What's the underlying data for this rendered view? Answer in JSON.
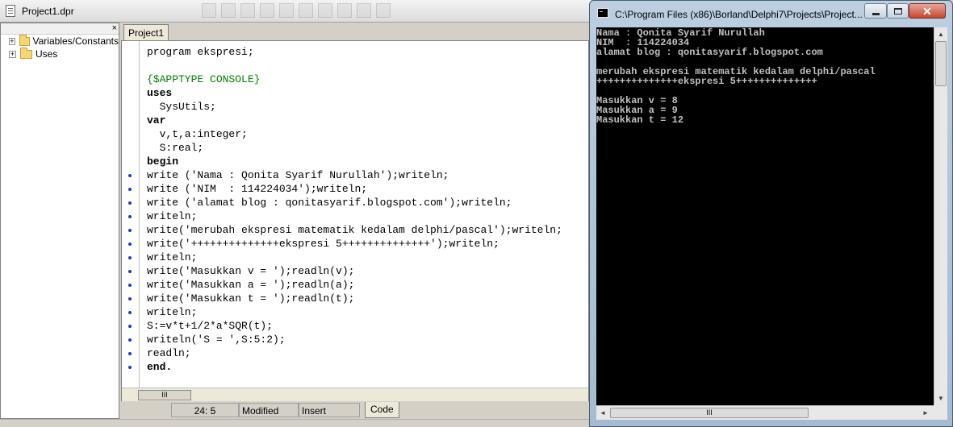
{
  "ide": {
    "title": "Project1.dpr",
    "explorer": {
      "close_glyph": "×",
      "items": [
        {
          "expander": "+",
          "label": "Variables/Constants"
        },
        {
          "expander": "+",
          "label": "Uses"
        }
      ]
    },
    "editor_tab": "Project1",
    "code_lines": [
      "program ekspresi;",
      "",
      "{$APPTYPE CONSOLE}",
      "uses",
      "  SysUtils;",
      "var",
      "  v,t,a:integer;",
      "  S:real;",
      "begin",
      "write ('Nama : Qonita Syarif Nurullah');writeln;",
      "write ('NIM  : 114224034');writeln;",
      "write ('alamat blog : qonitasyarif.blogspot.com');writeln;",
      "writeln;",
      "write('merubah ekspresi matematik kedalam delphi/pascal');writeln;",
      "write('++++++++++++++ekspresi 5++++++++++++++');writeln;",
      "writeln;",
      "write('Masukkan v = ');readln(v);",
      "write('Masukkan a = ');readln(a);",
      "write('Masukkan t = ');readln(t);",
      "writeln;",
      "S:=v*t+1/2*a*SQR(t);",
      "writeln('S = ',S:5:2);",
      "readln;",
      "end."
    ],
    "scroll_grip": "III",
    "status": {
      "position": "24:  5",
      "modified": "Modified",
      "mode": "Insert",
      "code_tab": "Code"
    }
  },
  "console": {
    "title": "C:\\Program Files (x86)\\Borland\\Delphi7\\Projects\\Project...",
    "buttons": {
      "close": "✕"
    },
    "lines": [
      "Nama : Qonita Syarif Nurullah",
      "NIM  : 114224034",
      "alamat blog : qonitasyarif.blogspot.com",
      "",
      "merubah ekspresi matematik kedalam delphi/pascal",
      "++++++++++++++ekspresi 5++++++++++++++",
      "",
      "Masukkan v = 8",
      "Masukkan a = 9",
      "Masukkan t = 12"
    ],
    "scroll_grip": "III",
    "arrows": {
      "up": "▲",
      "down": "▼",
      "left": "◄",
      "right": "►"
    }
  }
}
